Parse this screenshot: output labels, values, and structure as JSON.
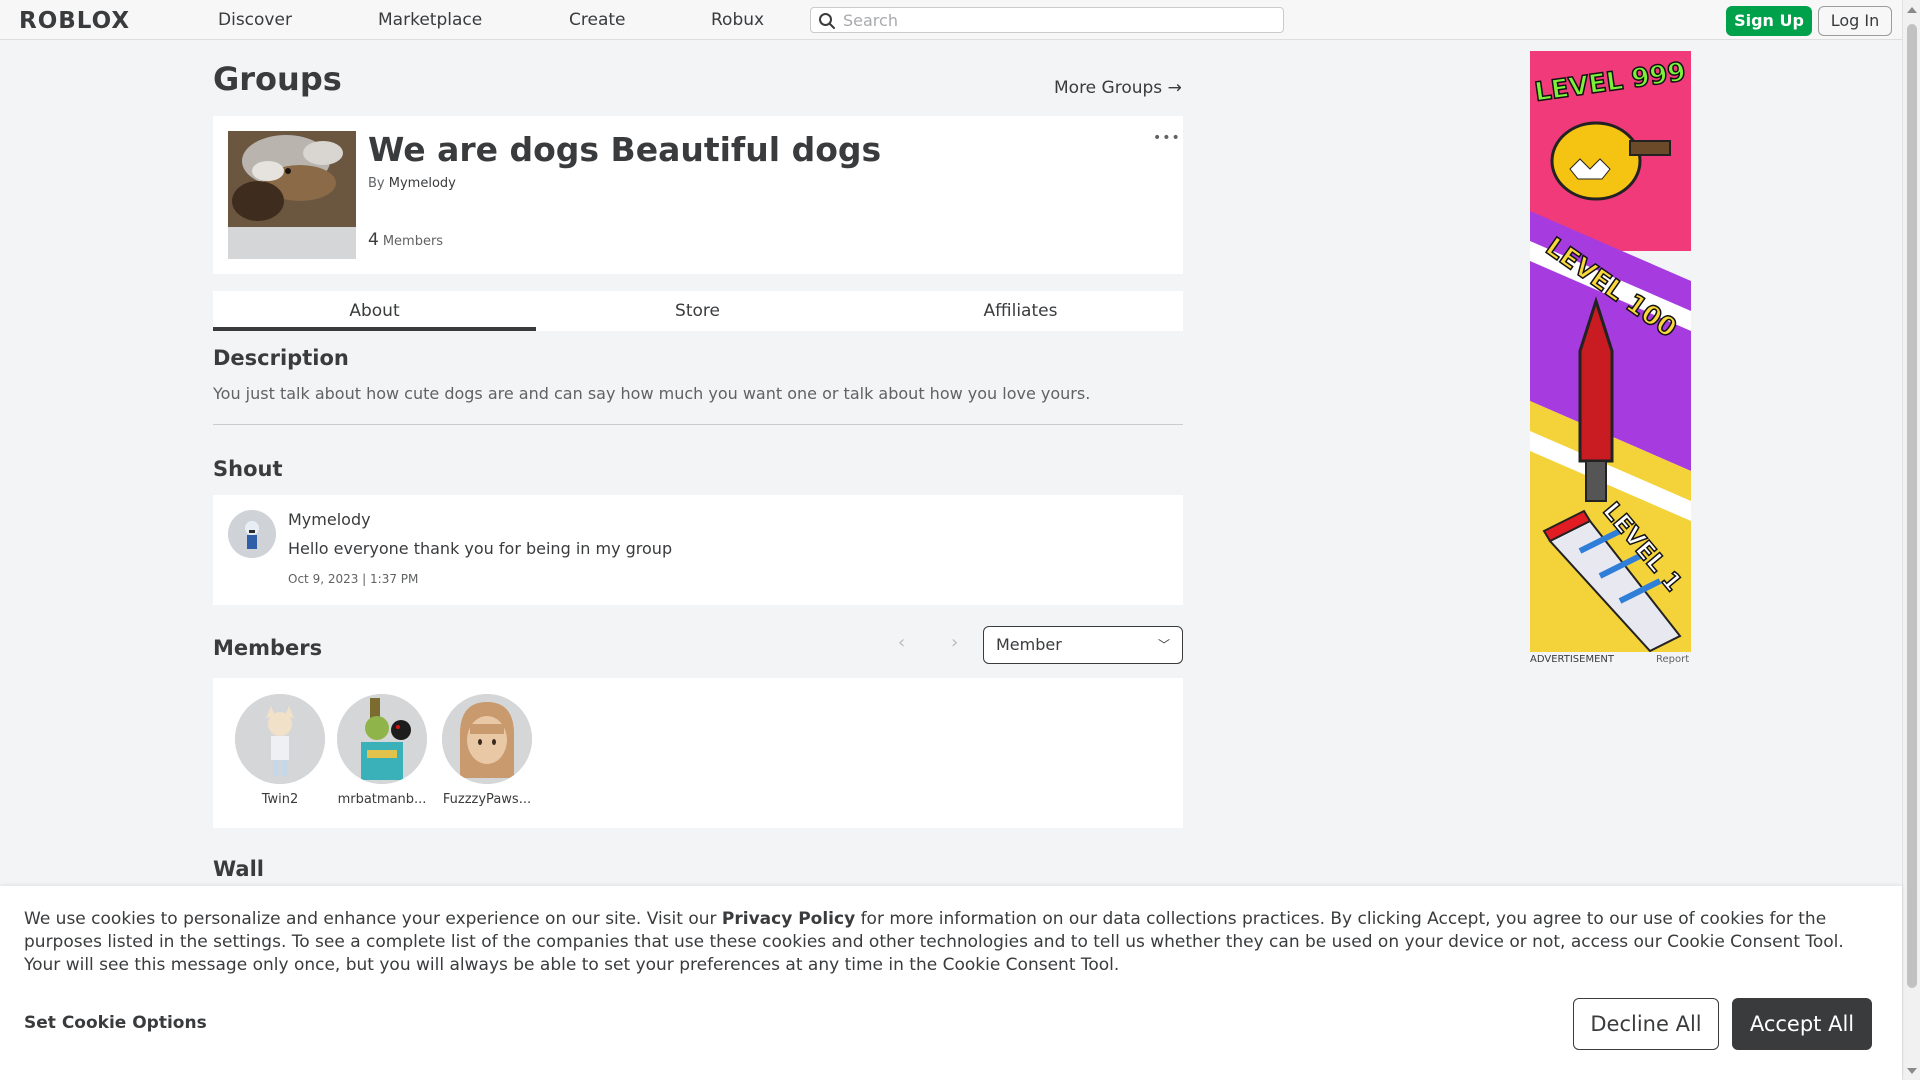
{
  "nav": {
    "logo": "ROBLOX",
    "links": [
      "Discover",
      "Marketplace",
      "Create",
      "Robux"
    ],
    "search_placeholder": "Search",
    "signup": "Sign Up",
    "login": "Log In"
  },
  "page": {
    "title": "Groups",
    "more_groups": "More Groups →"
  },
  "group": {
    "name": "We are dogs Beautiful dogs",
    "by_prefix": "By",
    "owner": "Mymelody",
    "member_count": "4",
    "member_label": "Members",
    "menu_icon": "•••"
  },
  "tabs": [
    "About",
    "Store",
    "Affiliates"
  ],
  "description": {
    "title": "Description",
    "text": "You just talk about how cute dogs are and can say how much you want one or talk about how you love yours."
  },
  "shout": {
    "title": "Shout",
    "user": "Mymelody",
    "body": "Hello everyone thank you for being in my group",
    "date": "Oct 9, 2023 | 1:37 PM"
  },
  "members": {
    "title": "Members",
    "role": "Member",
    "list": [
      "Twin2",
      "mrbatmanb...",
      "FuzzzyPaws..."
    ]
  },
  "wall": {
    "title": "Wall"
  },
  "ad": {
    "label": "ADVERTISEMENT",
    "report": "Report",
    "texts": [
      "LEVEL 999",
      "LEVEL 100",
      "LEVEL 1"
    ]
  },
  "cookie": {
    "text_before": "We use cookies to personalize and enhance your experience on our site. Visit our ",
    "privacy_link": "Privacy Policy",
    "text_after": " for more information on our data collections practices. By clicking Accept, you agree to our use of cookies for the purposes listed in the settings. To see a complete list of the companies that use these cookies and other technologies and to tell us whether they can be used on your device or not, access our Cookie Consent Tool. Your will see this message only once, but you will always be able to set your preferences at any time in the Cookie Consent Tool.",
    "options": "Set Cookie Options",
    "decline": "Decline All",
    "accept": "Accept All"
  },
  "colors": {
    "signup_green": "#00a14b",
    "accept_dark": "#393b3d",
    "page_bg": "#f2f4f5"
  }
}
